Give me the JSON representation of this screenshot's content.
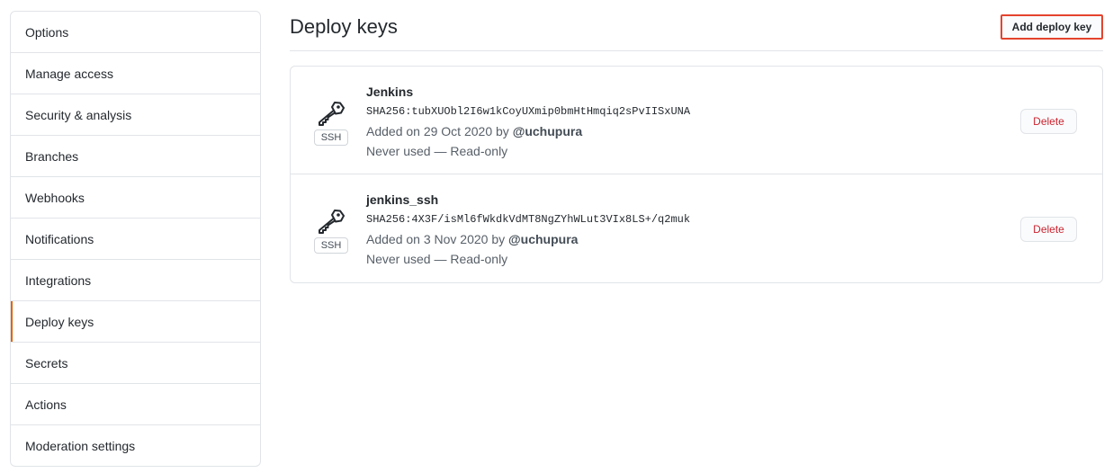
{
  "sidebar": {
    "items": [
      {
        "label": "Options"
      },
      {
        "label": "Manage access"
      },
      {
        "label": "Security & analysis"
      },
      {
        "label": "Branches"
      },
      {
        "label": "Webhooks"
      },
      {
        "label": "Notifications"
      },
      {
        "label": "Integrations"
      },
      {
        "label": "Deploy keys",
        "selected": true
      },
      {
        "label": "Secrets"
      },
      {
        "label": "Actions"
      },
      {
        "label": "Moderation settings"
      }
    ]
  },
  "main": {
    "title": "Deploy keys",
    "add_button_label": "Add deploy key",
    "keys": [
      {
        "icon": "key-icon",
        "type_badge": "SSH",
        "title": "Jenkins",
        "fingerprint": "SHA256:tubXUObl2I6w1kCoyUXmip0bmHtHmqiq2sPvIISxUNA",
        "added_prefix": "Added on 29 Oct 2020 by",
        "added_by": "@uchupura",
        "usage": "Never used — Read-only",
        "delete_label": "Delete"
      },
      {
        "icon": "key-icon",
        "type_badge": "SSH",
        "title": "jenkins_ssh",
        "fingerprint": "SHA256:4X3F/isMl6fWkdkVdMT8NgZYhWLut3VIx8LS+/q2muk",
        "added_prefix": "Added on 3 Nov 2020 by",
        "added_by": "@uchupura",
        "usage": "Never used — Read-only",
        "delete_label": "Delete"
      }
    ]
  },
  "colors": {
    "selected_indicator": "#e36209",
    "highlight_border": "#e4432d",
    "danger": "#cb2431"
  }
}
